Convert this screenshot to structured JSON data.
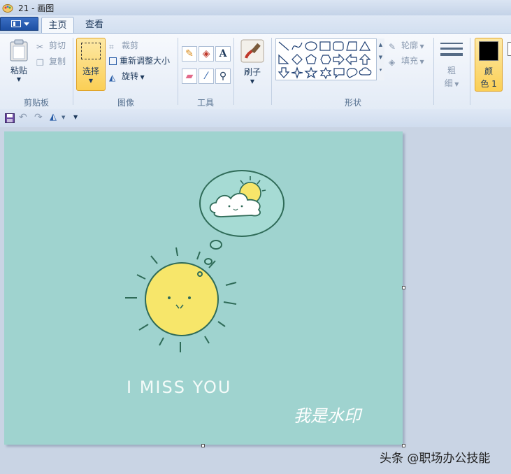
{
  "window": {
    "title": "21 - 画图"
  },
  "tabs": {
    "home": "主页",
    "view": "查看"
  },
  "clipboard": {
    "paste": "粘贴",
    "cut": "剪切",
    "copy": "复制",
    "group_label": "剪贴板"
  },
  "image_group": {
    "select": "选择",
    "crop": "裁剪",
    "resize": "重新调整大小",
    "rotate": "旋转",
    "group_label": "图像"
  },
  "tools_group": {
    "group_label": "工具",
    "text_glyph": "A"
  },
  "brushes": {
    "label": "刷子"
  },
  "shapes_group": {
    "outline": "轮廓",
    "fill": "填充",
    "group_label": "形状"
  },
  "size": {
    "label_line1": "粗",
    "label_line2": "细"
  },
  "color1": {
    "label_line1": "颜",
    "label_line2": "色 1"
  },
  "canvas": {
    "background": "#9fd3cf",
    "text_main": "I MISS YOU",
    "watermark": "我是水印"
  },
  "credit": "头条 @职场办公技能"
}
